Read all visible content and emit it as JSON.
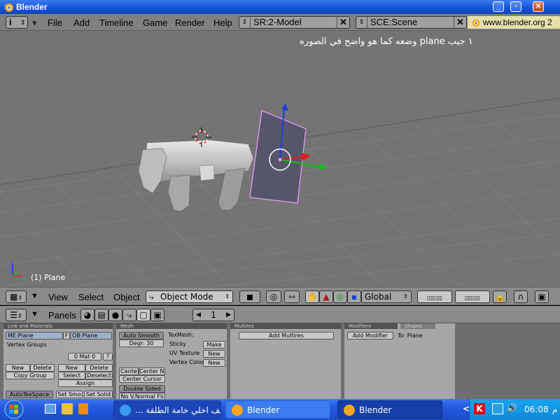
{
  "window": {
    "title": "Blender"
  },
  "menubar": {
    "items": [
      "File",
      "Add",
      "Timeline",
      "Game",
      "Render",
      "Help"
    ],
    "screen_field": "SR:2-Model",
    "scene_field": "SCE:Scene",
    "link": "www.blender.org 2"
  },
  "viewport": {
    "annotation": "١ جيب plane وضعه كما هو واضح في الصوره",
    "object_label": "(1) Plane"
  },
  "header3d": {
    "view": "View",
    "select": "Select",
    "object": "Object",
    "mode": "Object Mode",
    "orientation": "Global"
  },
  "buttons_header": {
    "panels_label": "Panels",
    "frame": "1"
  },
  "panels": {
    "link_materials": {
      "title": "Link and Materials",
      "me_field": "ME:Plane",
      "f_label": "F",
      "ob_field": "OB:Plane",
      "vertex_groups": "Vertex Groups",
      "mat_field": "0 Mat 0",
      "mat_q": "?",
      "new": "New",
      "delete": "Delete",
      "copy_group": "Copy Group",
      "new2": "New",
      "delete2": "Delete",
      "select": "Select",
      "deselect": "Deselect",
      "assign": "Assign",
      "autotexspace": "AutoTexSpace",
      "set_smooth": "Set Smo",
      "set_solid": "Set Solid"
    },
    "mesh": {
      "title": "Mesh",
      "auto_smooth": "Auto Smooth",
      "degr": "Degr: 30",
      "texmesh": "TexMesh:",
      "sticky": "Sticky",
      "make": "Make",
      "uv_texture": "UV Texture",
      "new_uv": "New",
      "vertex_color": "Vertex Color",
      "new_vc": "New",
      "center": "Cente",
      "center_new": "Center Ne",
      "center_cursor": "Center Cursor",
      "double_sided": "Double Sided",
      "no_vnormal": "No V.Normal Fli"
    },
    "multires": {
      "title": "Multires",
      "add_multires": "Add Multires"
    },
    "modifiers": {
      "tab_modifiers": "Modifiers",
      "tab_shapes": "Shapes",
      "add_modifier": "Add Modifier",
      "to_plane": "To: Plane"
    }
  },
  "taskbar": {
    "task1": "... كيف اخلي خامة الطلقة",
    "task2": "Blender",
    "task3": "Blender",
    "time": "06:08",
    "ampm": "م"
  }
}
